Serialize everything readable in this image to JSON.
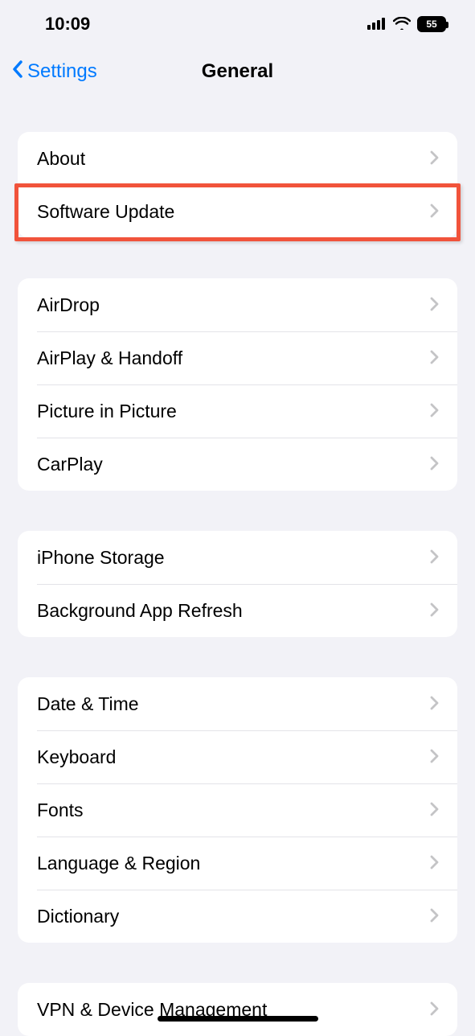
{
  "status": {
    "time": "10:09",
    "battery": "55"
  },
  "nav": {
    "back_label": "Settings",
    "title": "General"
  },
  "sections": [
    {
      "rows": [
        {
          "id": "about",
          "label": "About"
        },
        {
          "id": "software-update",
          "label": "Software Update",
          "highlighted": true
        }
      ]
    },
    {
      "rows": [
        {
          "id": "airdrop",
          "label": "AirDrop"
        },
        {
          "id": "airplay-handoff",
          "label": "AirPlay & Handoff"
        },
        {
          "id": "picture-in-picture",
          "label": "Picture in Picture"
        },
        {
          "id": "carplay",
          "label": "CarPlay"
        }
      ]
    },
    {
      "rows": [
        {
          "id": "iphone-storage",
          "label": "iPhone Storage"
        },
        {
          "id": "background-app-refresh",
          "label": "Background App Refresh"
        }
      ]
    },
    {
      "rows": [
        {
          "id": "date-time",
          "label": "Date & Time"
        },
        {
          "id": "keyboard",
          "label": "Keyboard"
        },
        {
          "id": "fonts",
          "label": "Fonts"
        },
        {
          "id": "language-region",
          "label": "Language & Region"
        },
        {
          "id": "dictionary",
          "label": "Dictionary"
        }
      ]
    },
    {
      "rows": [
        {
          "id": "vpn-device-management",
          "label": "VPN & Device Management"
        }
      ]
    }
  ]
}
